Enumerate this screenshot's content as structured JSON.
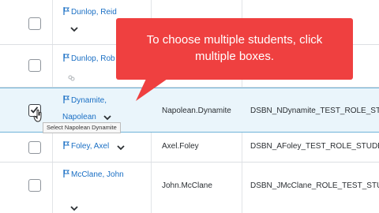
{
  "rows": [
    {
      "name": "Dunlop, Reid",
      "username": "",
      "org_id": "",
      "checked": false
    },
    {
      "name": "Dunlop, Rob",
      "username": "",
      "org_id": "",
      "checked": false
    },
    {
      "name": "Dynamite, Napolean",
      "name_line1": "Dynamite,",
      "name_line2": "Napolean",
      "username": "Napolean.Dynamite",
      "org_id": "DSBN_NDynamite_TEST_ROLE_STU",
      "checked": true
    },
    {
      "name": "Foley, Axel",
      "username": "Axel.Foley",
      "org_id": "DSBN_AFoley_TEST_ROLE_STUDEN",
      "checked": false
    },
    {
      "name": "McClane, John",
      "username": "John.McClane",
      "org_id": "DSBN_JMcClane_ROLE_TEST_STU",
      "checked": false
    }
  ],
  "callout": {
    "line1": "To choose multiple students, click",
    "line2": "multiple boxes."
  },
  "tooltip": "Select Napolean Dynamite",
  "colors": {
    "link": "#1a6fc4",
    "callout": "#ef4040",
    "selected_row": "#eaf5fb"
  }
}
